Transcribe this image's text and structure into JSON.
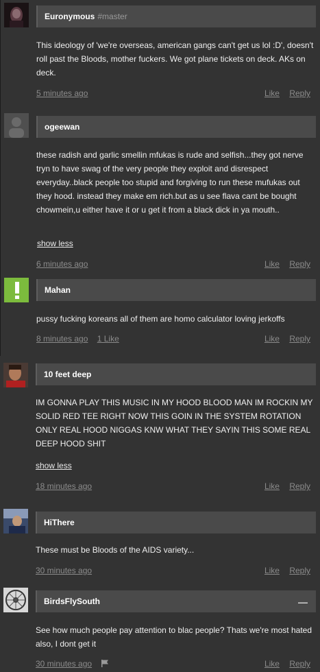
{
  "comments": [
    {
      "name": "Euronymous",
      "tag": "#master",
      "text": "This ideology of 'we're overseas, american gangs can't get us lol :D', doesn't roll past the Bloods, mother fuckers. We got plane tickets on deck. AKs on deck.",
      "time": "5 minutes ago",
      "like_label": "Like",
      "reply_label": "Reply"
    },
    {
      "name": "ogeewan",
      "text": "these radish and garlic smellin mfukas is rude and selfish...they got nerve tryn to have swag of the very people they exploit and disrespect everyday..black people too stupid and forgiving to run these mufukas out they hood. instead they make em rich.but as u see flava cant be bought chowmein,u either have it or u get it from a black dick in ya mouth..",
      "show_less": "show less",
      "time": "6 minutes ago",
      "like_label": "Like",
      "reply_label": "Reply"
    },
    {
      "name": "Mahan",
      "text": "pussy fucking koreans all of them are homo calculator  loving jerkoffs",
      "time": "8 minutes ago",
      "likes": "1 Like",
      "like_label": "Like",
      "reply_label": "Reply"
    },
    {
      "name": "10 feet deep",
      "text": "IM GONNA PLAY THIS MUSIC IN MY HOOD BLOOD MAN IM ROCKIN MY SOLID RED TEE RIGHT NOW THIS GOIN IN THE SYSTEM ROTATION ONLY REAL HOOD NIGGAS KNW WHAT THEY SAYIN THIS SOME REAL DEEP HOOD SHIT",
      "show_less": "show less",
      "time": "18 minutes ago",
      "like_label": "Like",
      "reply_label": "Reply"
    },
    {
      "name": "HiThere",
      "text": "These must be Bloods of the AIDS variety...",
      "time": "30 minutes ago",
      "like_label": "Like",
      "reply_label": "Reply"
    },
    {
      "name": "BirdsFlySouth",
      "collapse_label": "—",
      "text": "See how much people pay attention to blac people? Thats we're most hated also, I dont get it",
      "time": "30 minutes ago",
      "like_label": "Like",
      "reply_label": "Reply"
    }
  ],
  "icons": {
    "mahan_avatar": "exclamation-icon",
    "flag": "flag-icon"
  },
  "colors": {
    "background": "#333333",
    "name_bar": "#4a4a4a",
    "meta_text": "#8c8c8c",
    "mahan_avatar": "#7cbb3d"
  }
}
